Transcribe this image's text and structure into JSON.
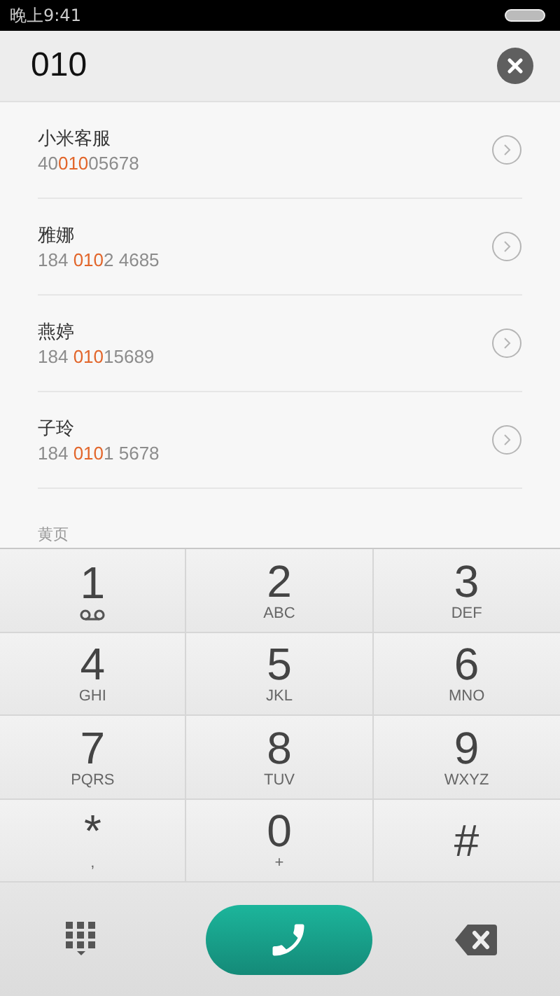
{
  "status_bar": {
    "time": "晚上9:41"
  },
  "search": {
    "value": "010"
  },
  "results": [
    {
      "name": "小米客服",
      "number": [
        {
          "text": "40",
          "match": false
        },
        {
          "text": "010",
          "match": true
        },
        {
          "text": "05678",
          "match": false
        }
      ]
    },
    {
      "name": "雅娜",
      "number": [
        {
          "text": "184 ",
          "match": false
        },
        {
          "text": "010",
          "match": true
        },
        {
          "text": "2 4685",
          "match": false
        }
      ]
    },
    {
      "name": "燕婷",
      "number": [
        {
          "text": "184 ",
          "match": false
        },
        {
          "text": "010",
          "match": true
        },
        {
          "text": "15689",
          "match": false
        }
      ]
    },
    {
      "name": "子玲",
      "number": [
        {
          "text": "184 ",
          "match": false
        },
        {
          "text": "010",
          "match": true
        },
        {
          "text": "1 5678",
          "match": false
        }
      ]
    }
  ],
  "section_label": "黄页",
  "keypad": [
    {
      "digit": "1",
      "kind": "voicemail"
    },
    {
      "digit": "2",
      "letters": "ABC",
      "kind": "letters"
    },
    {
      "digit": "3",
      "letters": "DEF",
      "kind": "letters"
    },
    {
      "digit": "4",
      "letters": "GHI",
      "kind": "letters"
    },
    {
      "digit": "5",
      "letters": "JKL",
      "kind": "letters"
    },
    {
      "digit": "6",
      "letters": "MNO",
      "kind": "letters"
    },
    {
      "digit": "7",
      "letters": "PQRS",
      "kind": "letters"
    },
    {
      "digit": "8",
      "letters": "TUV",
      "kind": "letters"
    },
    {
      "digit": "9",
      "letters": "WXYZ",
      "kind": "letters"
    },
    {
      "digit": "*",
      "letters": ",",
      "kind": "letters"
    },
    {
      "digit": "0",
      "letters": "+",
      "kind": "letters"
    },
    {
      "digit": "#",
      "kind": "plain"
    }
  ]
}
